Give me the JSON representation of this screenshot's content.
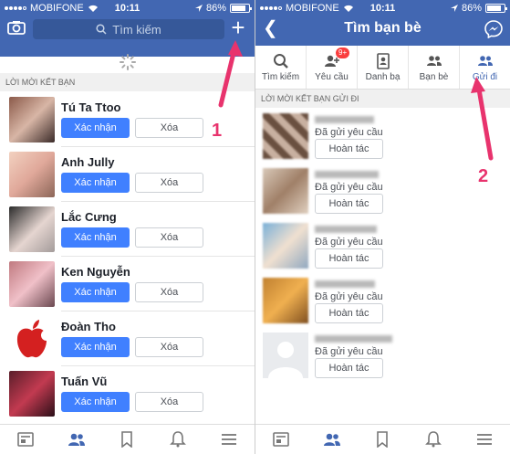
{
  "left": {
    "status": {
      "carrier": "MOBIFONE",
      "time": "10:11",
      "battery": "86%"
    },
    "search": {
      "placeholder": "Tìm kiếm"
    },
    "section_header": "LỜI MỜI KẾT BẠN",
    "requests": [
      {
        "name": "Tú Ta Ttoo",
        "confirm": "Xác nhận",
        "delete": "Xóa"
      },
      {
        "name": "Anh Jully",
        "confirm": "Xác nhận",
        "delete": "Xóa"
      },
      {
        "name": "Lắc Cưng",
        "confirm": "Xác nhận",
        "delete": "Xóa"
      },
      {
        "name": "Ken Nguyễn",
        "confirm": "Xác nhận",
        "delete": "Xóa"
      },
      {
        "name": "Đoàn Tho",
        "confirm": "Xác nhận",
        "delete": "Xóa"
      },
      {
        "name": "Tuấn Vũ",
        "confirm": "Xác nhận",
        "delete": "Xóa"
      }
    ],
    "step": "1"
  },
  "right": {
    "status": {
      "carrier": "MOBIFONE",
      "time": "10:11",
      "battery": "86%"
    },
    "title": "Tìm bạn bè",
    "tabs": [
      {
        "label": "Tìm kiếm",
        "icon": "search-icon"
      },
      {
        "label": "Yêu cầu",
        "icon": "friend-requests-icon",
        "badge": "9+"
      },
      {
        "label": "Danh bạ",
        "icon": "contacts-icon"
      },
      {
        "label": "Bạn bè",
        "icon": "friends-icon"
      },
      {
        "label": "Gửi đi",
        "icon": "sent-icon"
      }
    ],
    "section_header": "LỜI MỜI KẾT BẠN GỬI ĐI",
    "sent": [
      {
        "status": "Đã gửi yêu cầu",
        "undo": "Hoàn tác"
      },
      {
        "status": "Đã gửi yêu cầu",
        "undo": "Hoàn tác"
      },
      {
        "status": "Đã gửi yêu cầu",
        "undo": "Hoàn tác"
      },
      {
        "status": "Đã gửi yêu cầu",
        "undo": "Hoàn tác"
      },
      {
        "status": "Đã gửi yêu cầu",
        "undo": "Hoàn tác"
      }
    ],
    "step": "2"
  },
  "colors": {
    "header": "#4267b2",
    "confirm": "#4080ff",
    "annotation": "#e8336d",
    "badge": "#fa3e3e"
  }
}
